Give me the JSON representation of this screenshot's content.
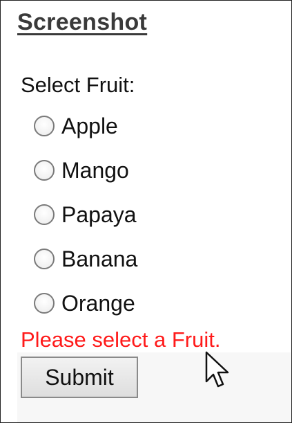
{
  "page": {
    "title": "Screenshot"
  },
  "form": {
    "field_label": "Select Fruit:",
    "options": [
      {
        "label": "Apple",
        "selected": false
      },
      {
        "label": "Mango",
        "selected": false
      },
      {
        "label": "Papaya",
        "selected": false
      },
      {
        "label": "Banana",
        "selected": false
      },
      {
        "label": "Orange",
        "selected": false
      }
    ],
    "error_message": "Please select a Fruit.",
    "submit_label": "Submit"
  },
  "colors": {
    "error": "#ff1a1a",
    "title": "#3a3a3a",
    "text": "#111111"
  },
  "icons": {
    "cursor": "mouse-pointer-icon"
  }
}
